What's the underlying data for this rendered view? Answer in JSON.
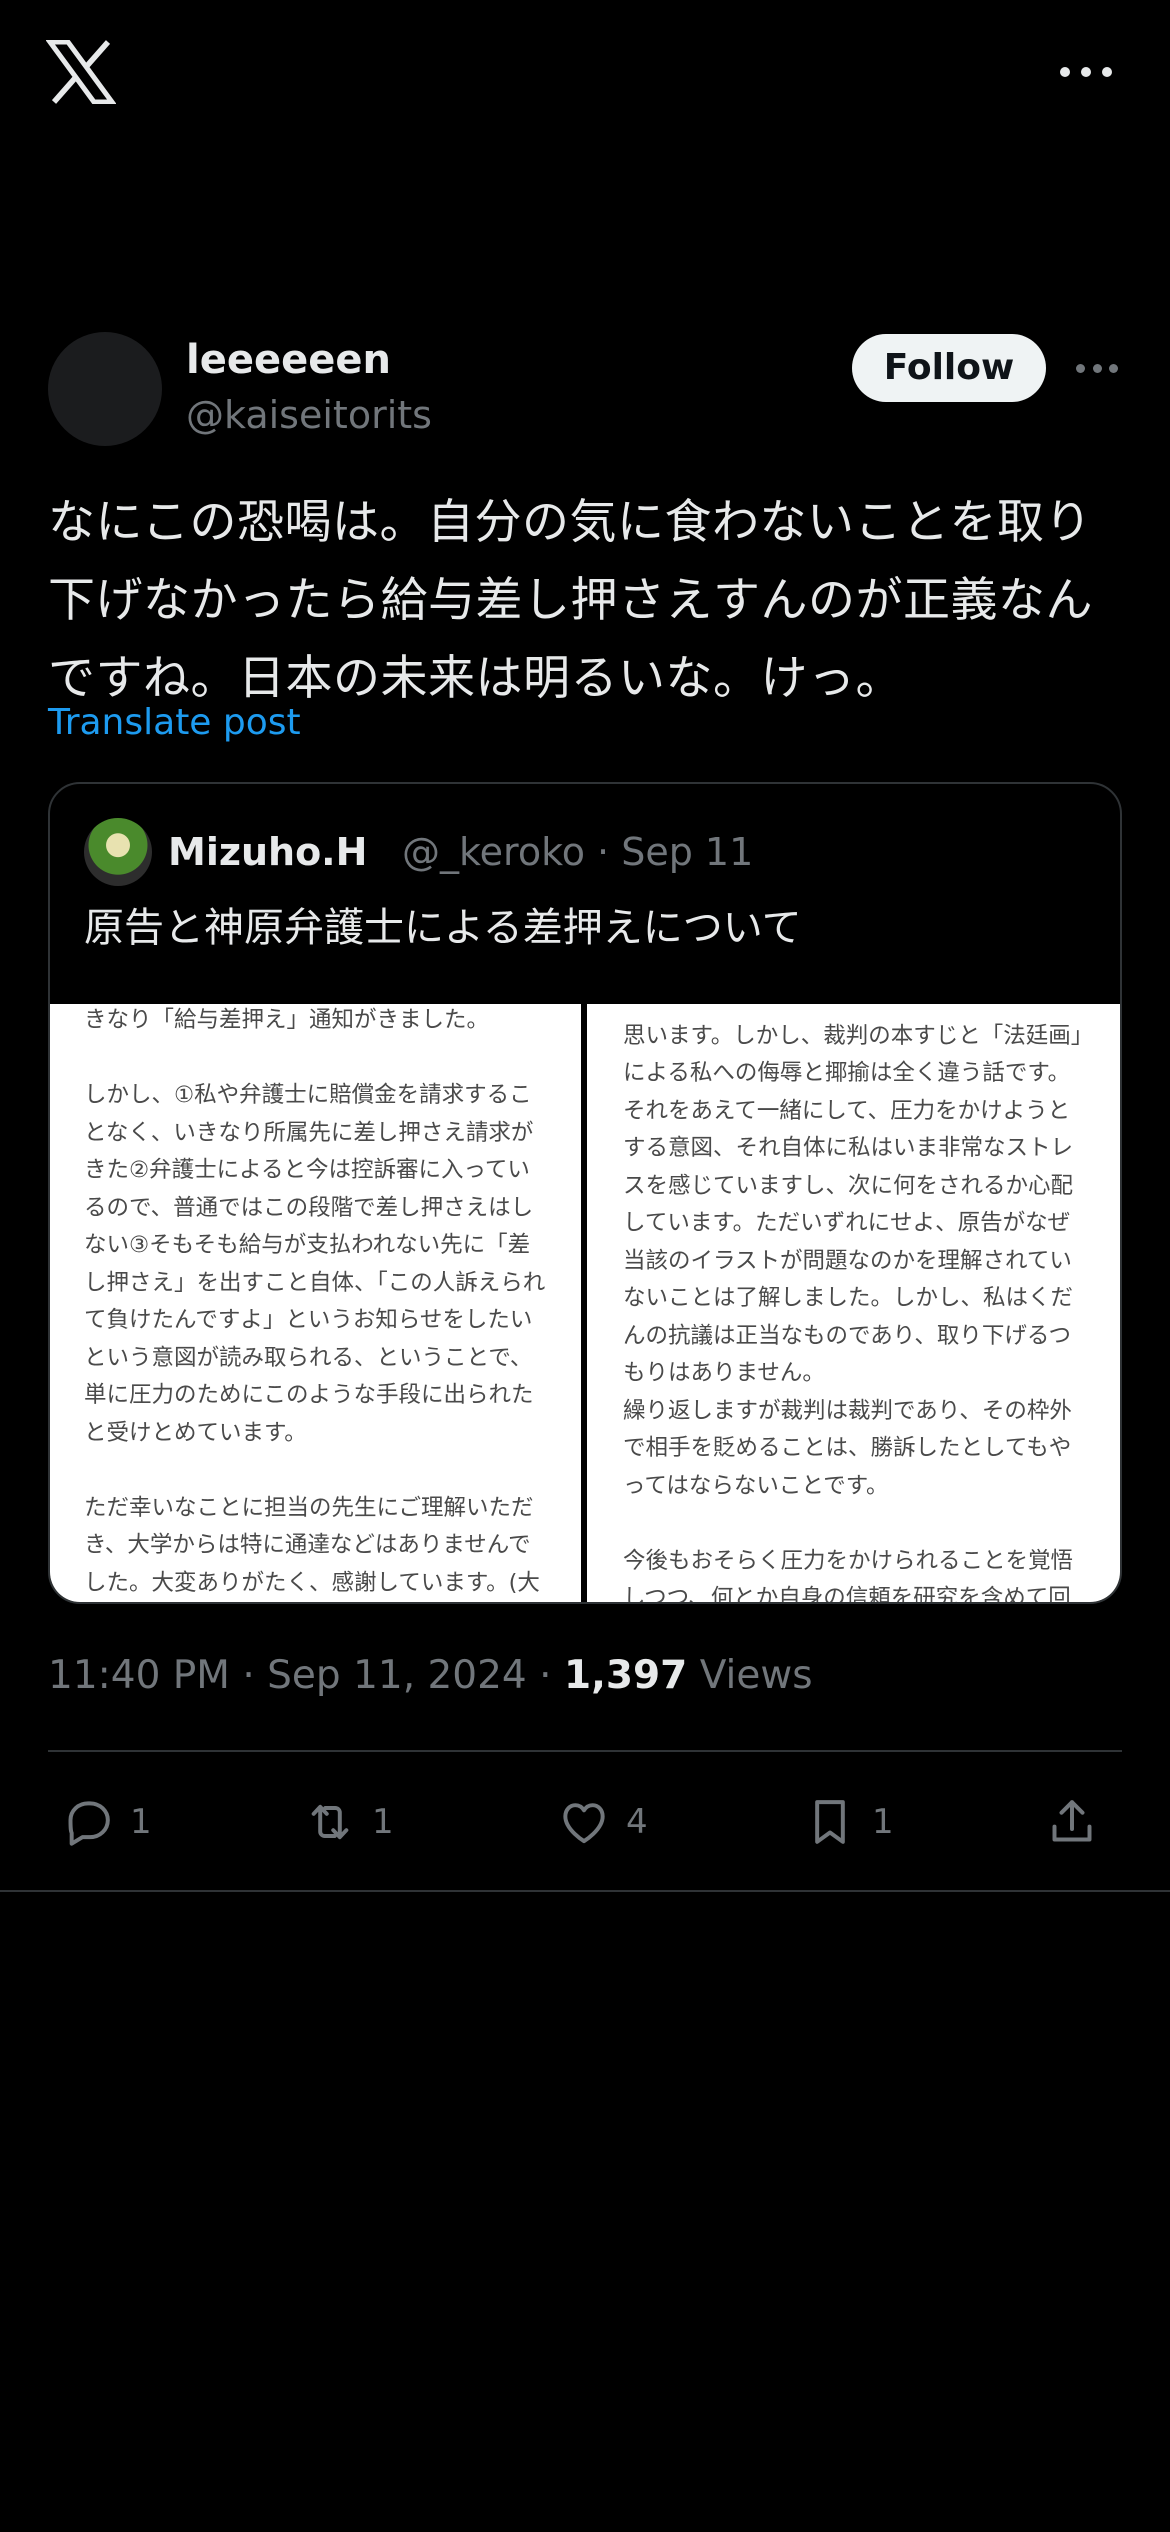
{
  "post": {
    "author_name": "leeeeeen",
    "author_handle": "@kaiseitorits",
    "follow_label": "Follow",
    "text": "なにこの恐喝は。自分の気に食わないことを取り下げなかったら給与差し押さえすんのが正義なんですね。日本の未来は明るいな。けっ。",
    "translate_label": "Translate post",
    "time": "11:40 PM",
    "date": "Sep 11, 2024",
    "views_count": "1,397",
    "views_label": "Views"
  },
  "quote": {
    "name": "Mizuho.H",
    "handle": "@_keroko",
    "date": "Sep 11",
    "text": "原告と神原弁護士による差押えについて",
    "image_left_lines": [
      "きなり「給与差押え」通知がきました。",
      "",
      "しかし、①私や弁護士に賠償金を請求するこ",
      "となく、いきなり所属先に差し押さえ請求が",
      "きた②弁護士によると今は控訴審に入ってい",
      "るので、普通ではこの段階で差し押さえはし",
      "ない③そもそも給与が支払われない先に「差",
      "し押さえ」を出すこと自体、「この人訴えられ",
      "て負けたんですよ」というお知らせをしたい",
      "という意図が読み取られる、ということで、",
      "単に圧力のためにこのような手段に出られた",
      "と受けとめています。",
      "",
      "ただ幸いなことに担当の先生にご理解いただ",
      "き、大学からは特に通達などはありませんで",
      "した。大変ありがたく、感謝しています。(大"
    ],
    "image_right_lines": [
      "",
      "思います。しかし、裁判の本すじと「法廷画」",
      "による私への侮辱と揶揄は全く違う話です。",
      "それをあえて一緒にして、圧力をかけようと",
      "する意図、それ自体に私はいま非常なストレ",
      "スを感じていますし、次に何をされるか心配",
      "しています。ただいずれにせよ、原告がなぜ",
      "当該のイラストが問題なのかを理解されてい",
      "ないことは了解しました。しかし、私はくだ",
      "んの抗議は正当なものであり、取り下げるつ",
      "もりはありません。",
      "繰り返しますが裁判は裁判であり、その枠外",
      "で相手を貶めることは、勝訴したとしてもや",
      "ってはならないことです。",
      "",
      "今後もおそらく圧力をかけられることを覚悟",
      "しつつ、何とか自身の信頼を研究を含めて回"
    ]
  },
  "actions": {
    "reply_count": "1",
    "retweet_count": "1",
    "like_count": "4",
    "bookmark_count": "1"
  },
  "icons": {
    "app": "x-logo-icon",
    "more": "more-horizontal-icon",
    "reply": "reply-icon",
    "retweet": "retweet-icon",
    "like": "heart-icon",
    "bookmark": "bookmark-icon",
    "share": "share-icon"
  }
}
